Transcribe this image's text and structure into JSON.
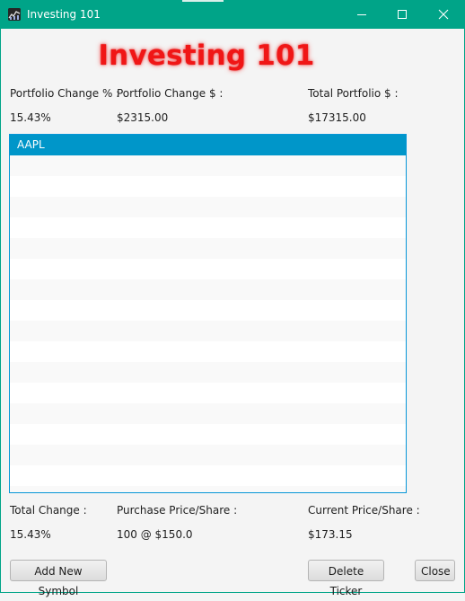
{
  "window": {
    "title": "Investing 101",
    "icon": "stock-chart-icon",
    "controls": [
      "minimize-icon",
      "maximize-icon",
      "close-icon"
    ]
  },
  "app_title": "Investing 101",
  "summary": {
    "change_pct_label": "Portfolio Change % :",
    "change_usd_label": "Portfolio Change $ :",
    "total_label": "Total Portfolio $ :",
    "change_pct_value": "15.43%",
    "change_usd_value": "$2315.00",
    "total_value": "$17315.00"
  },
  "symbols": {
    "items": [
      "AAPL"
    ],
    "selected": "AAPL"
  },
  "details": {
    "total_change_label": "Total Change :",
    "purchase_label": "Purchase Price/Share :",
    "current_label": "Current Price/Share :",
    "total_change_value": "15.43%",
    "purchase_value": "100 @ $150.0",
    "current_value": "$173.15"
  },
  "buttons": {
    "add": "Add New Symbol",
    "delete": "Delete Ticker",
    "close": "Close"
  },
  "colors": {
    "titlebar": "#00a488",
    "accent_title": "#f01616",
    "selection": "#0096c9"
  }
}
